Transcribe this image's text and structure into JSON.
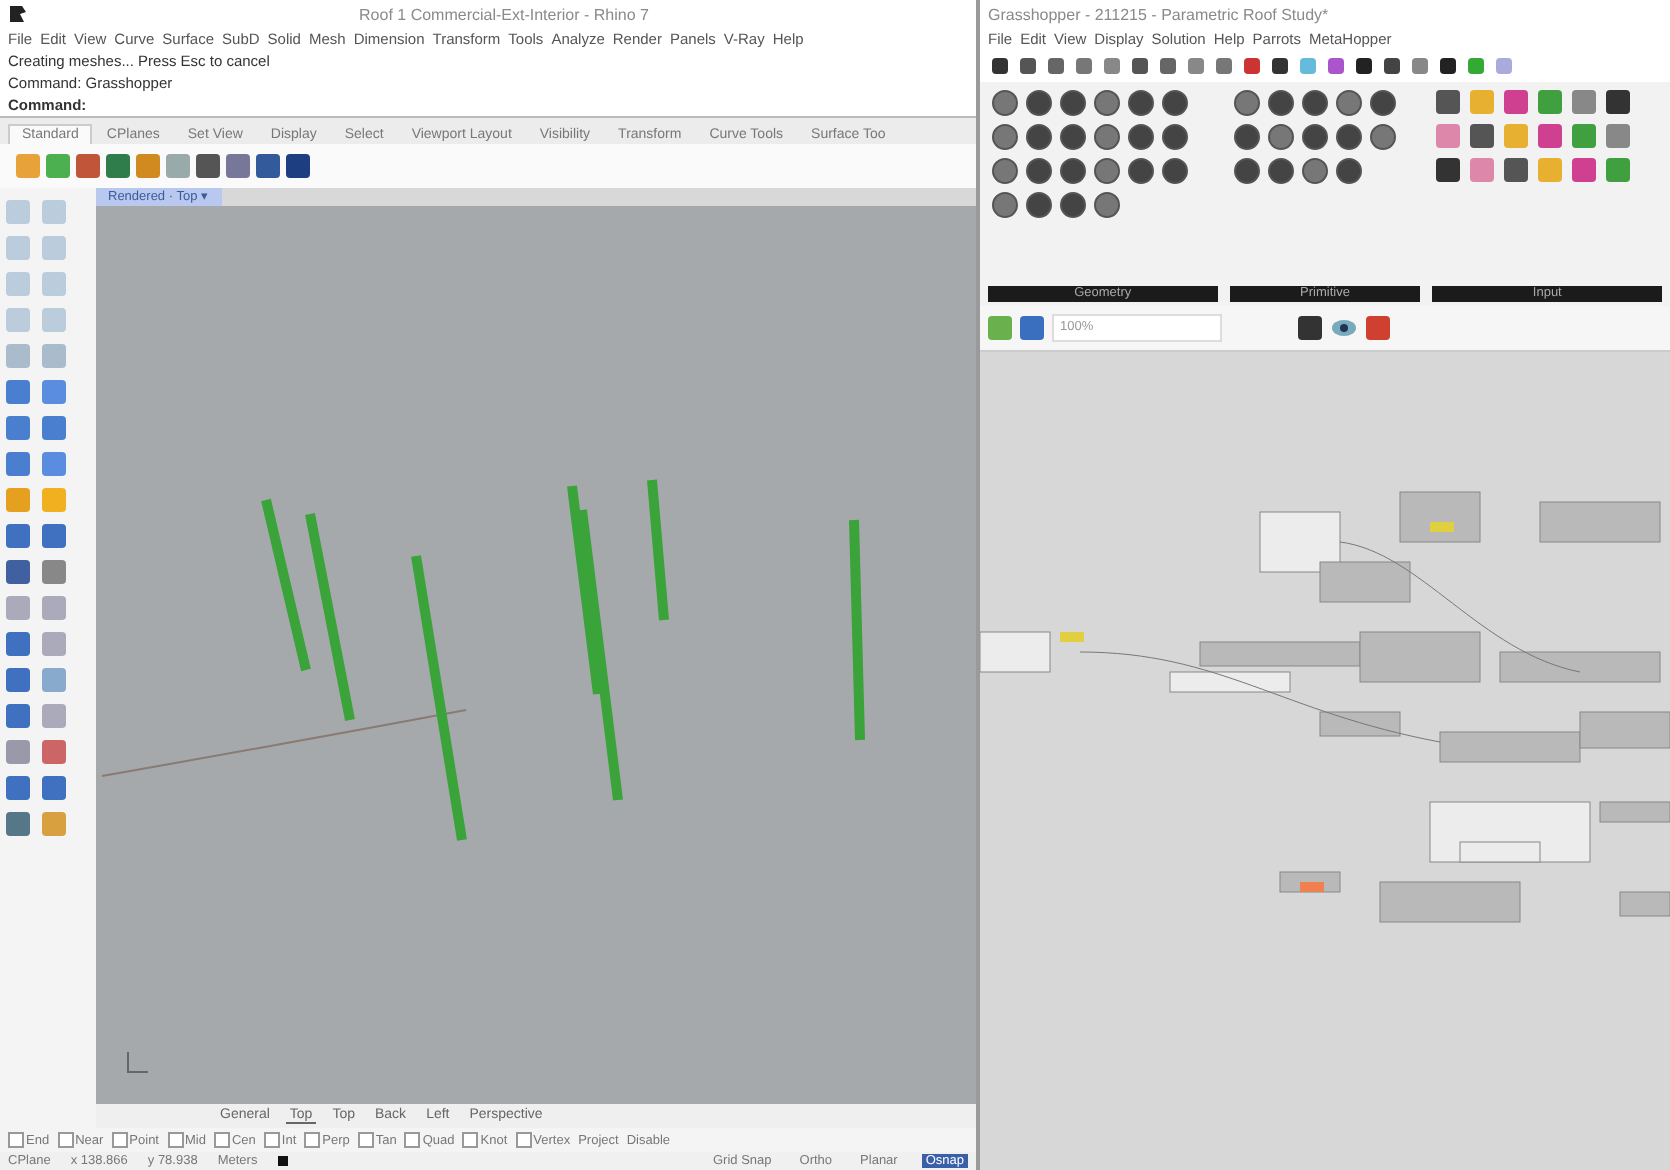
{
  "rhino": {
    "title": "Roof 1 Commercial-Ext-Interior - Rhino 7",
    "menu": [
      "File",
      "Edit",
      "View",
      "Curve",
      "Surface",
      "SubD",
      "Solid",
      "Mesh",
      "Dimension",
      "Transform",
      "Tools",
      "Analyze",
      "Render",
      "Panels",
      "V-Ray",
      "Help"
    ],
    "command_history": [
      "Creating meshes... Press Esc to cancel",
      "Command: Grasshopper"
    ],
    "command_prompt": "Command:",
    "toolbar_tabs": [
      {
        "label": "Standard",
        "selected": true
      },
      {
        "label": "CPlanes",
        "selected": false
      },
      {
        "label": "Set View",
        "selected": false
      },
      {
        "label": "Display",
        "selected": false
      },
      {
        "label": "Select",
        "selected": false
      },
      {
        "label": "Viewport Layout",
        "selected": false
      },
      {
        "label": "Visibility",
        "selected": false
      },
      {
        "label": "Transform",
        "selected": false
      },
      {
        "label": "Curve Tools",
        "selected": false
      },
      {
        "label": "Surface Too",
        "selected": false
      }
    ],
    "viewport": {
      "label": "Rendered · Top ▾"
    },
    "viewport_tabs": [
      {
        "label": "General",
        "selected": false
      },
      {
        "label": "Top",
        "selected": true
      },
      {
        "label": "Top",
        "selected": false
      },
      {
        "label": "Back",
        "selected": false
      },
      {
        "label": "Left",
        "selected": false
      },
      {
        "label": "Perspective",
        "selected": false
      }
    ],
    "osnaps": [
      {
        "label": "End",
        "checked": false
      },
      {
        "label": "Near",
        "checked": false
      },
      {
        "label": "Point",
        "checked": false
      },
      {
        "label": "Mid",
        "checked": false
      },
      {
        "label": "Cen",
        "checked": false
      },
      {
        "label": "Int",
        "checked": false
      },
      {
        "label": "Perp",
        "checked": false
      },
      {
        "label": "Tan",
        "checked": false
      },
      {
        "label": "Quad",
        "checked": false
      },
      {
        "label": "Knot",
        "checked": false
      },
      {
        "label": "Vertex",
        "checked": false
      }
    ],
    "osnap_options": [
      "Project",
      "Disable"
    ],
    "status_bar": {
      "cplane": "CPlane",
      "x": "x 138.866",
      "y": "y 78.938",
      "units": "Meters",
      "toggles": [
        {
          "label": "Grid Snap",
          "on": false
        },
        {
          "label": "Ortho",
          "on": false
        },
        {
          "label": "Planar",
          "on": false
        },
        {
          "label": "Osnap",
          "on": true
        }
      ]
    }
  },
  "grasshopper": {
    "title": "Grasshopper - 211215 - Parametric Roof Study*",
    "menu": [
      "File",
      "Edit",
      "View",
      "Display",
      "Solution",
      "Help",
      "Parrots",
      "MetaHopper"
    ],
    "panel_groups": [
      "Geometry",
      "Primitive",
      "Input"
    ],
    "zoom": "100%"
  }
}
